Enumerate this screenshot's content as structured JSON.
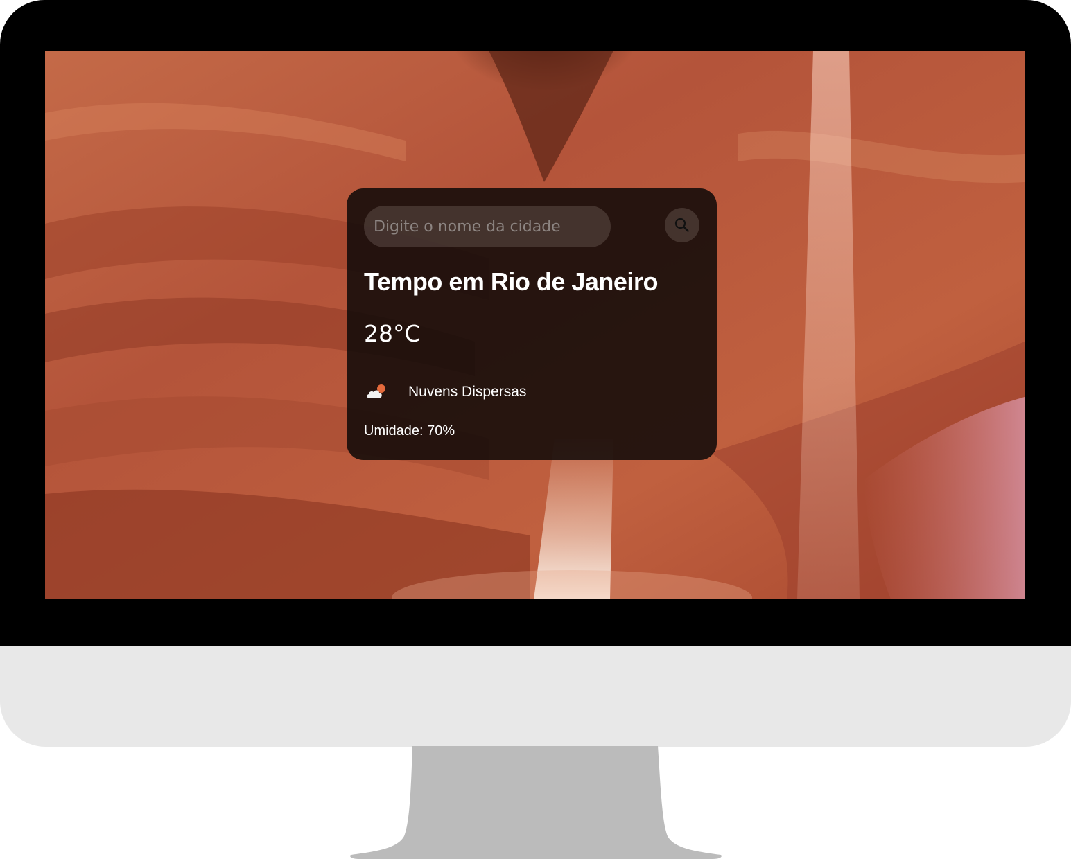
{
  "search": {
    "placeholder": "Digite o nome da cidade",
    "button_icon": "search-icon"
  },
  "weather": {
    "title": "Tempo em Rio de Janeiro",
    "temperature": "28°C",
    "condition_icon": "scattered-clouds-icon",
    "condition": "Nuvens Dispersas",
    "humidity": "Umidade: 70%"
  },
  "colors": {
    "bezel": "#000000",
    "chin": "#e8e8e8",
    "stand": "#bbbbbb",
    "card_background": "#0e0908",
    "text": "#ffffff",
    "wallpaper_rock": "#b8553a"
  }
}
